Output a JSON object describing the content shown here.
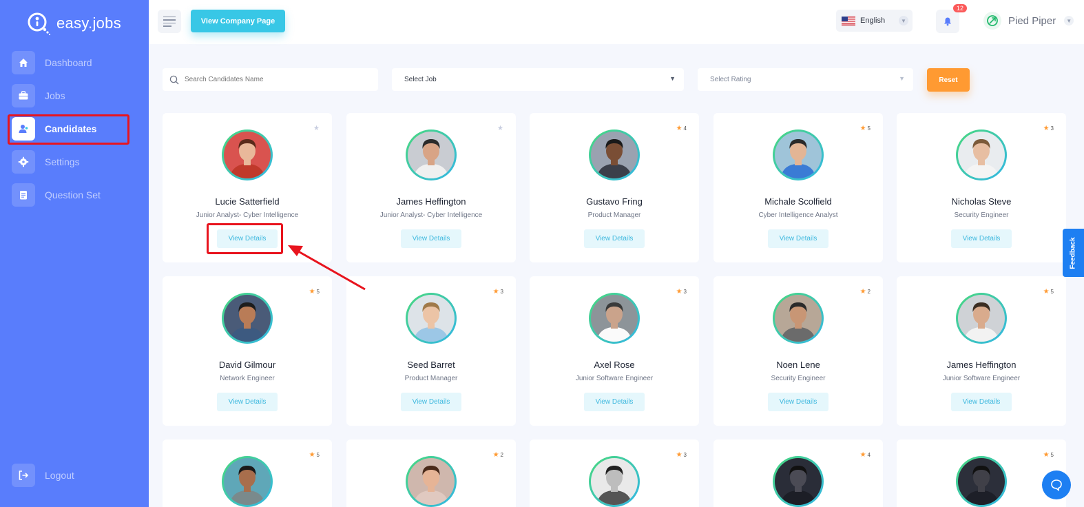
{
  "brand": {
    "name": "easy.jobs"
  },
  "sidebar": {
    "items": [
      {
        "label": "Dashboard",
        "icon": "home-icon"
      },
      {
        "label": "Jobs",
        "icon": "briefcase-icon"
      },
      {
        "label": "Candidates",
        "icon": "user-icon",
        "active": true
      },
      {
        "label": "Settings",
        "icon": "gear-icon"
      },
      {
        "label": "Question Set",
        "icon": "clipboard-icon"
      }
    ],
    "logout": "Logout"
  },
  "header": {
    "view_company_label": "View Company Page",
    "language": "English",
    "notification_count": "12",
    "company_name": "Pied Piper"
  },
  "filters": {
    "search_placeholder": "Search Candidates Name",
    "job_select": "Select Job",
    "rating_select": "Select Rating",
    "reset_label": "Reset"
  },
  "view_details_label": "View Details",
  "candidates": [
    {
      "name": "Lucie Satterfield",
      "role": "Junior Analyst- Cyber Intelligence",
      "rating": ""
    },
    {
      "name": "James Heffington",
      "role": "Junior Analyst- Cyber Intelligence",
      "rating": ""
    },
    {
      "name": "Gustavo Fring",
      "role": "Product Manager",
      "rating": "4"
    },
    {
      "name": "Michale Scolfield",
      "role": "Cyber Intelligence Analyst",
      "rating": "5"
    },
    {
      "name": "Nicholas Steve",
      "role": "Security Engineer",
      "rating": "3"
    },
    {
      "name": "David Gilmour",
      "role": "Network Engineer",
      "rating": "5"
    },
    {
      "name": "Seed Barret",
      "role": "Product Manager",
      "rating": "3"
    },
    {
      "name": "Axel Rose",
      "role": "Junior Software Engineer",
      "rating": "3"
    },
    {
      "name": "Noen Lene",
      "role": "Security Engineer",
      "rating": "2"
    },
    {
      "name": "James Heffington",
      "role": "Junior Software Engineer",
      "rating": "5"
    },
    {
      "name": "",
      "role": "",
      "rating": "5"
    },
    {
      "name": "",
      "role": "",
      "rating": "2"
    },
    {
      "name": "",
      "role": "",
      "rating": "3"
    },
    {
      "name": "",
      "role": "",
      "rating": "4"
    },
    {
      "name": "",
      "role": "",
      "rating": "5"
    }
  ],
  "feedback_label": "Feedback",
  "colors": {
    "sidebar_bg": "#597dfc",
    "accent_cyan": "#38c7e6",
    "accent_orange": "#ff9a32",
    "star_orange": "#ff9a32",
    "highlight_red": "#e8141e"
  }
}
